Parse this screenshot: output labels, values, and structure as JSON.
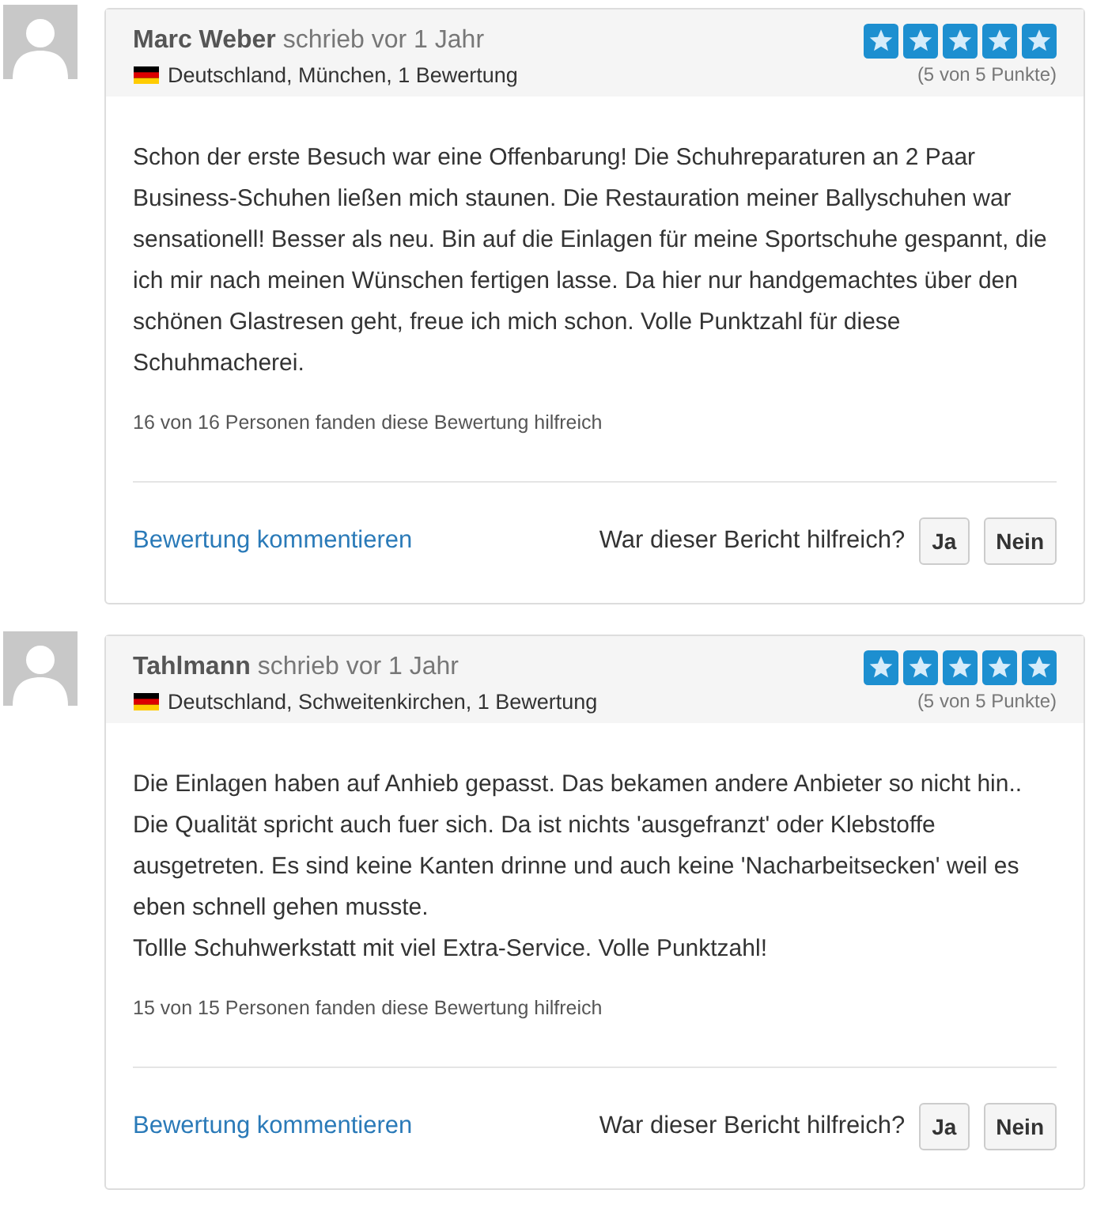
{
  "reviews": [
    {
      "author": "Marc Weber",
      "wrote": "schrieb vor 1 Jahr",
      "location": "Deutschland, München, 1 Bewertung",
      "stars": 5,
      "score": "(5 von 5 Punkte)",
      "paragraphs": [
        "Schon der erste Besuch war eine Offenbarung! Die Schuhreparaturen an 2 Paar Business-Schuhen ließen mich staunen. Die Restauration meiner Ballyschuhen war sensationell! Besser als neu. Bin auf die Einlagen für meine Sportschuhe gespannt, die ich mir nach meinen Wünschen fertigen lasse. Da hier nur handgemachtes über den schönen Glastresen geht, freue ich mich schon. Volle Punktzahl für diese Schuhmacherei."
      ],
      "helpful_count": "16 von 16 Personen fanden diese Bewertung hilfreich",
      "comment_link": "Bewertung kommentieren",
      "question": "War dieser Bericht hilfreich?",
      "yes": "Ja",
      "no": "Nein"
    },
    {
      "author": "Tahlmann",
      "wrote": "schrieb vor 1 Jahr",
      "location": "Deutschland, Schweitenkirchen, 1 Bewertung",
      "stars": 5,
      "score": "(5 von 5 Punkte)",
      "paragraphs": [
        "Die Einlagen haben auf Anhieb gepasst. Das bekamen andere Anbieter so nicht hin.. Die Qualität spricht auch fuer sich. Da ist nichts 'ausgefranzt' oder Klebstoffe ausgetreten. Es sind keine Kanten drinne und auch keine 'Nacharbeitsecken' weil es eben schnell gehen musste.",
        "Tollle Schuhwerkstatt mit viel Extra-Service. Volle Punktzahl!"
      ],
      "helpful_count": "15 von 15 Personen fanden diese Bewertung hilfreich",
      "comment_link": "Bewertung kommentieren",
      "question": "War dieser Bericht hilfreich?",
      "yes": "Ja",
      "no": "Nein"
    }
  ]
}
